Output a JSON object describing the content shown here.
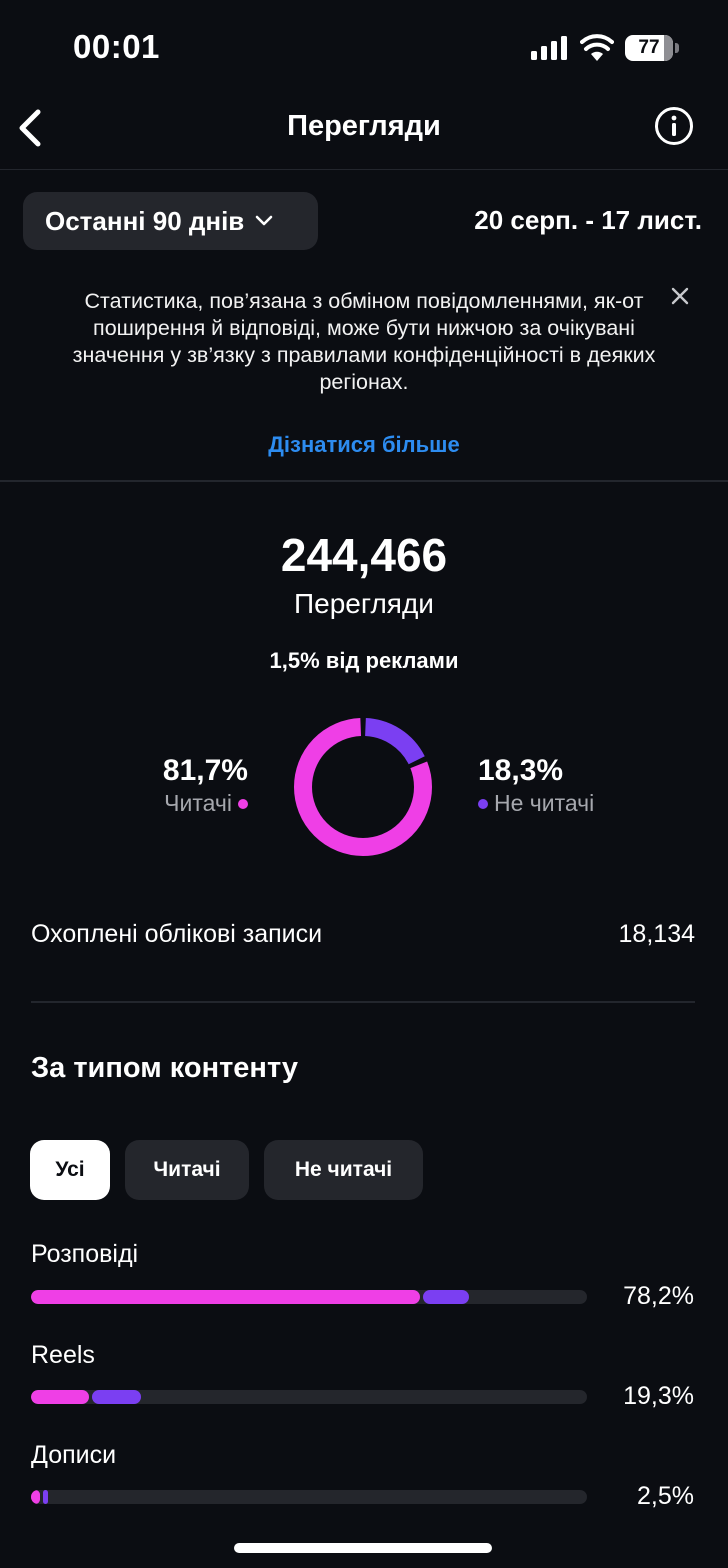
{
  "status_bar": {
    "time": "00:01",
    "battery": "77"
  },
  "nav": {
    "title": "Перегляди"
  },
  "filter": {
    "range_label": "Останні 90 днів",
    "date_range": "20 серп. - 17 лист."
  },
  "notice": {
    "text": "Статистика, пов’язана з обміном повідомленнями, як-от поширення й відповіді, може бути нижчою за очікувані значення у зв’язку з правилами конфіденційності в деяких регіонах.",
    "link": "Дізнатися більше"
  },
  "summary": {
    "total": "244,466",
    "label": "Перегляди",
    "ads_share": "1,5% від реклами",
    "followers_pct": "81,7%",
    "followers_label": "Читачі",
    "followers_fraction": 0.817,
    "nonfollowers_pct": "18,3%",
    "nonfollowers_label": "Не читачі",
    "nonfollowers_fraction": 0.183
  },
  "colors": {
    "followers": "#ef3fe6",
    "nonfollowers": "#7b3ff2",
    "link": "#2d8cf0"
  },
  "reach": {
    "label": "Охоплені облікові записи",
    "value": "18,134"
  },
  "content_type": {
    "title": "За типом контенту",
    "filters": [
      "Усі",
      "Читачі",
      "Не читачі"
    ],
    "active_filter": "Усі",
    "rows": [
      {
        "label": "Розповіді",
        "pct": "78,2%",
        "followers": 0.7,
        "nonfollowers": 0.082
      },
      {
        "label": "Reels",
        "pct": "19,3%",
        "followers": 0.105,
        "nonfollowers": 0.088
      },
      {
        "label": "Дописи",
        "pct": "2,5%",
        "followers": 0.017,
        "nonfollowers": 0.008
      }
    ]
  }
}
